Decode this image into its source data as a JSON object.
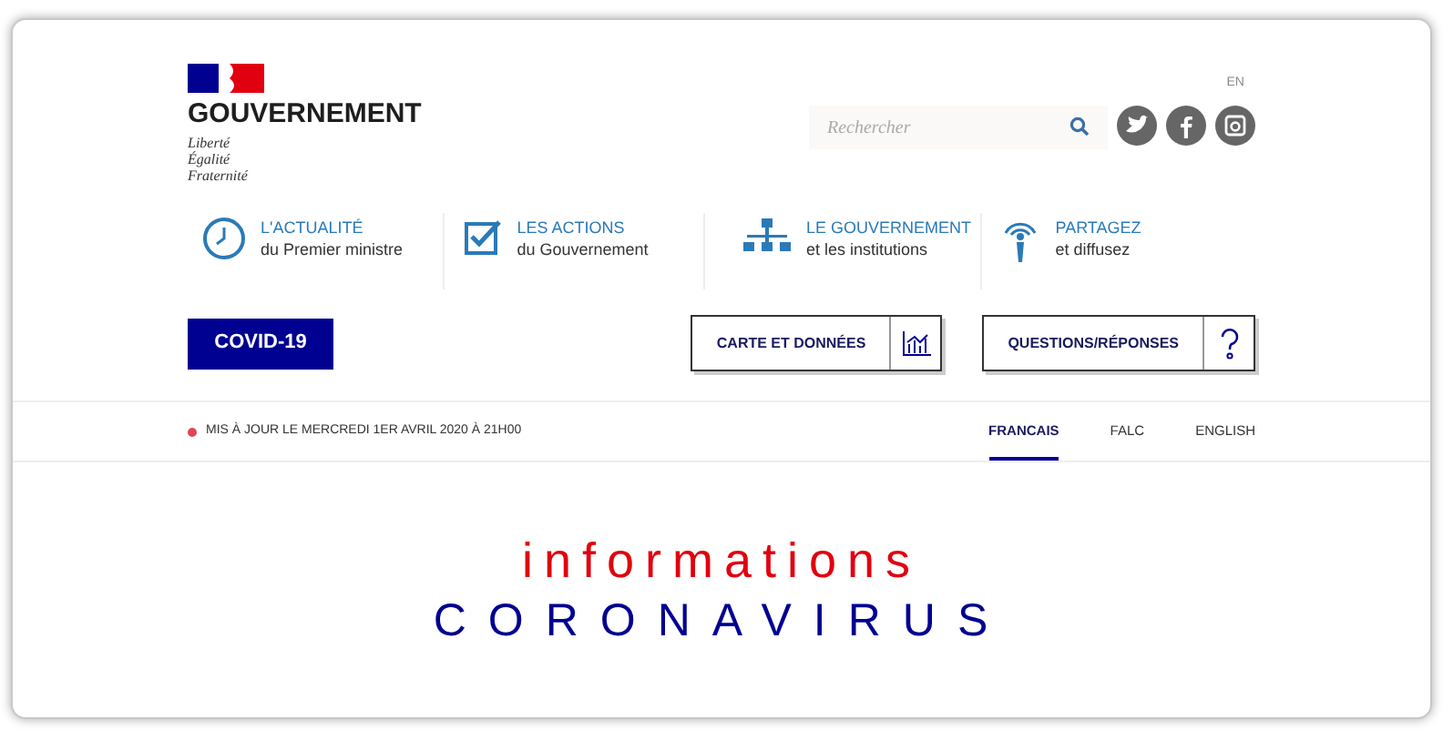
{
  "header": {
    "wordmark": "GOUVERNEMENT",
    "motto": [
      "Liberté",
      "Égalité",
      "Fraternité"
    ],
    "language_link": "EN",
    "search": {
      "placeholder": "Rechercher"
    }
  },
  "nav": [
    {
      "kind": "clock",
      "title": "L'ACTUALITÉ",
      "subtitle": "du Premier ministre"
    },
    {
      "kind": "check",
      "title": "LES ACTIONS",
      "subtitle": "du Gouvernement"
    },
    {
      "kind": "org",
      "title": "LE GOUVERNEMENT",
      "subtitle": "et les institutions"
    },
    {
      "kind": "share",
      "title": "PARTAGEZ",
      "subtitle": "et diffusez"
    }
  ],
  "covid_button": "COVID-19",
  "action_buttons": [
    {
      "kind": "chart",
      "label": "CARTE ET DONNÉES"
    },
    {
      "kind": "question",
      "label": "QUESTIONS/RÉPONSES"
    }
  ],
  "update_notice": "MIS À JOUR LE MERCREDI 1ER AVRIL 2020 À 21H00",
  "languages": [
    {
      "label": "FRANCAIS",
      "selected": true
    },
    {
      "label": "FALC",
      "selected": false
    },
    {
      "label": "ENGLISH",
      "selected": false
    }
  ],
  "hero": {
    "line_1": "informations",
    "line_2": "CORONAVIRUS"
  }
}
